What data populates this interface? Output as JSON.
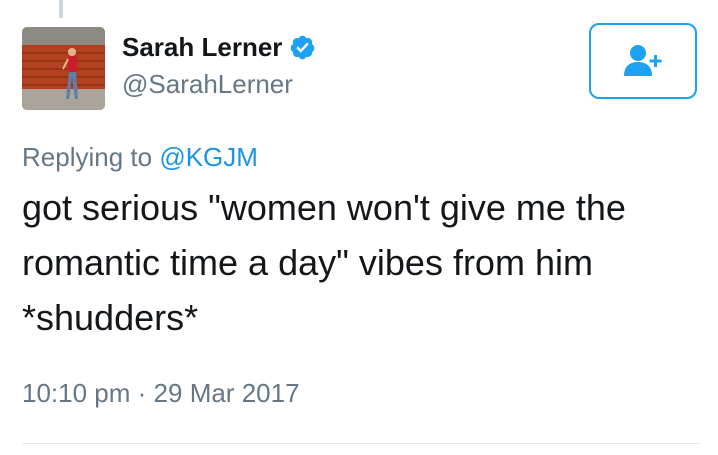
{
  "user": {
    "display_name": "Sarah Lerner",
    "handle": "@SarahLerner",
    "verified": true,
    "avatar_description_icon": "profile-photo"
  },
  "follow_button": {
    "icon": "add-user-icon"
  },
  "reply_context": {
    "prefix": "Replying to",
    "mention": "@KGJM"
  },
  "tweet": {
    "lines": [
      "got serious \"women won't give me the",
      "romantic time a day\" vibes from him",
      "*shudders*"
    ]
  },
  "meta": {
    "time": "10:10 pm",
    "separator": "·",
    "date": "29 Mar 2017"
  },
  "colors": {
    "accent": "#1da1f2",
    "mention": "#1b95e0",
    "muted": "#657786",
    "text": "#14171a",
    "divider": "#e1e8ed"
  }
}
